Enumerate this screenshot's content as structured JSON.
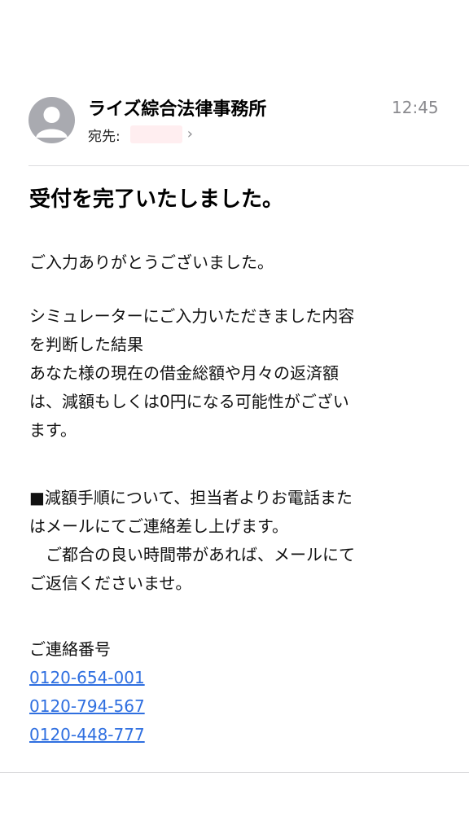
{
  "header": {
    "sender": "ライズ綜合法律事務所",
    "time": "12:45",
    "recipient_label": "宛先:",
    "recipient_chevron": "›"
  },
  "subject": "受付を完了いたしました。",
  "body": {
    "greeting": "ご入力ありがとうございました。",
    "para2": [
      "シミュレーターにご入力いただきました内容",
      "を判断した結果",
      "あなた様の現在の借金総額や月々の返済額",
      "は、減額もしくは0円になる可能性がござい",
      "ます。"
    ],
    "para3": [
      "■減額手順について、担当者よりお電話また",
      "はメールにてご連絡差し上げます。",
      "　ご都合の良い時間帯があれば、メールにて",
      "ご返信くださいませ。"
    ],
    "contact_label": "ご連絡番号",
    "phones": [
      "0120-654-001",
      "0120-794-567",
      "0120-448-777"
    ]
  },
  "colors": {
    "link": "#2f6fe0",
    "avatar": "#a9aab0",
    "time": "#8a8a8e",
    "redacted_chip": "#ffeef0"
  },
  "icons": {
    "avatar": "person-icon",
    "recipient_more": "chevron-right-icon"
  }
}
